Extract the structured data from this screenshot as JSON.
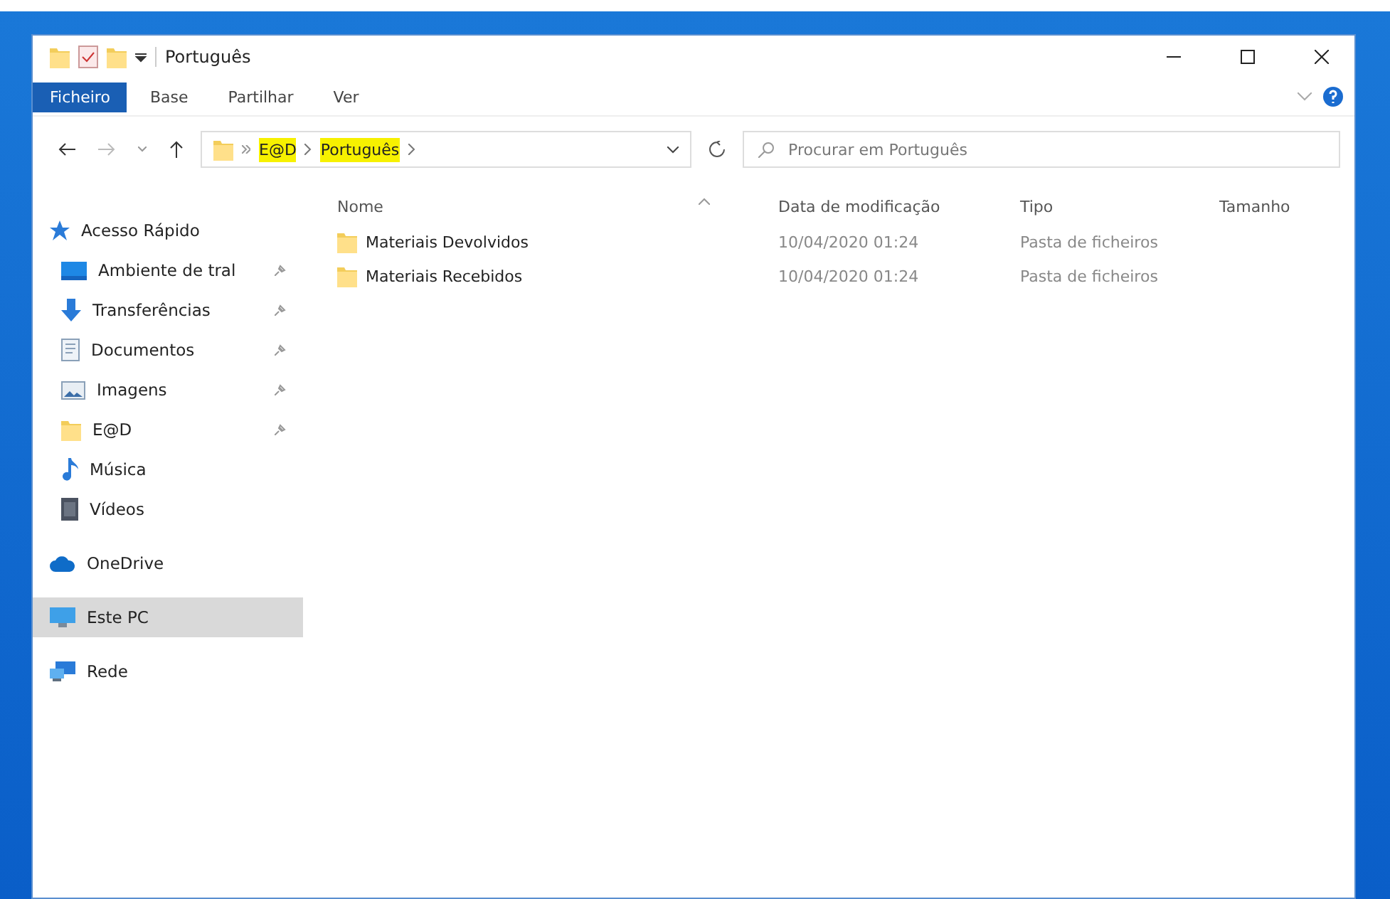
{
  "window": {
    "title": "Português"
  },
  "ribbon_tabs": [
    {
      "label": "Ficheiro",
      "selected": true
    },
    {
      "label": "Base",
      "selected": false
    },
    {
      "label": "Partilhar",
      "selected": false
    },
    {
      "label": "Ver",
      "selected": false
    }
  ],
  "address_bar": {
    "breadcrumbs": [
      {
        "label": "E@D",
        "highlighted": true
      },
      {
        "label": "Português",
        "highlighted": true
      }
    ]
  },
  "search": {
    "placeholder": "Procurar em Português"
  },
  "sidebar": {
    "items": [
      {
        "label": "Acesso Rápido",
        "kind": "star",
        "pinned": false,
        "selected": false,
        "children": [
          {
            "label": "Ambiente de tral",
            "kind": "desktop",
            "pinned": true,
            "selected": false
          },
          {
            "label": "Transferências",
            "kind": "download",
            "pinned": true,
            "selected": false
          },
          {
            "label": "Documentos",
            "kind": "document",
            "pinned": true,
            "selected": false
          },
          {
            "label": "Imagens",
            "kind": "image",
            "pinned": true,
            "selected": false
          },
          {
            "label": "E@D",
            "kind": "folder",
            "pinned": true,
            "selected": false
          },
          {
            "label": "Música",
            "kind": "music",
            "pinned": false,
            "selected": false
          },
          {
            "label": "Vídeos",
            "kind": "video",
            "pinned": false,
            "selected": false
          }
        ]
      },
      {
        "label": "OneDrive",
        "kind": "cloud",
        "pinned": false,
        "selected": false
      },
      {
        "label": "Este PC",
        "kind": "pc",
        "pinned": false,
        "selected": true
      },
      {
        "label": "Rede",
        "kind": "network",
        "pinned": false,
        "selected": false
      }
    ]
  },
  "table": {
    "columns": [
      "Nome",
      "Data de modificação",
      "Tipo",
      "Tamanho"
    ],
    "rows": [
      {
        "name": "Materiais Devolvidos",
        "modified": "10/04/2020 01:24",
        "type": "Pasta de ficheiros"
      },
      {
        "name": "Materiais Recebidos",
        "modified": "10/04/2020 01:24",
        "type": "Pasta de ficheiros"
      }
    ]
  }
}
